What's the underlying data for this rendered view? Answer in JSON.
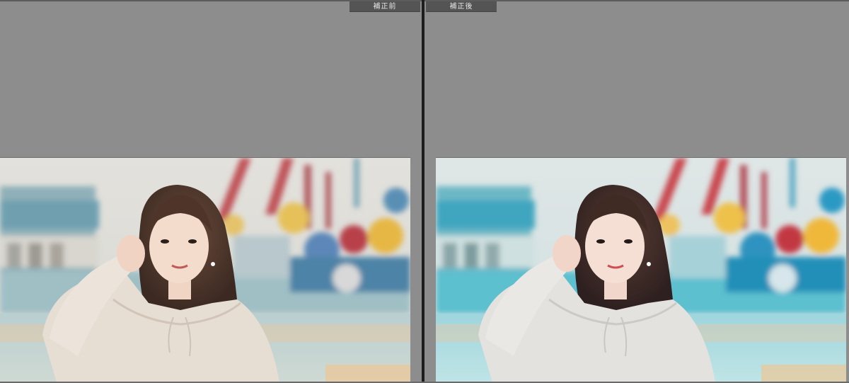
{
  "panes": {
    "before": {
      "label": "補正前"
    },
    "after": {
      "label": "補正後"
    }
  },
  "colors": {
    "background": "#8d8d8d",
    "tab_background": "#545454",
    "divider": "#1e1e1e",
    "before_tint": "#d8cdbf",
    "after_tint": "#bfe3ea"
  }
}
